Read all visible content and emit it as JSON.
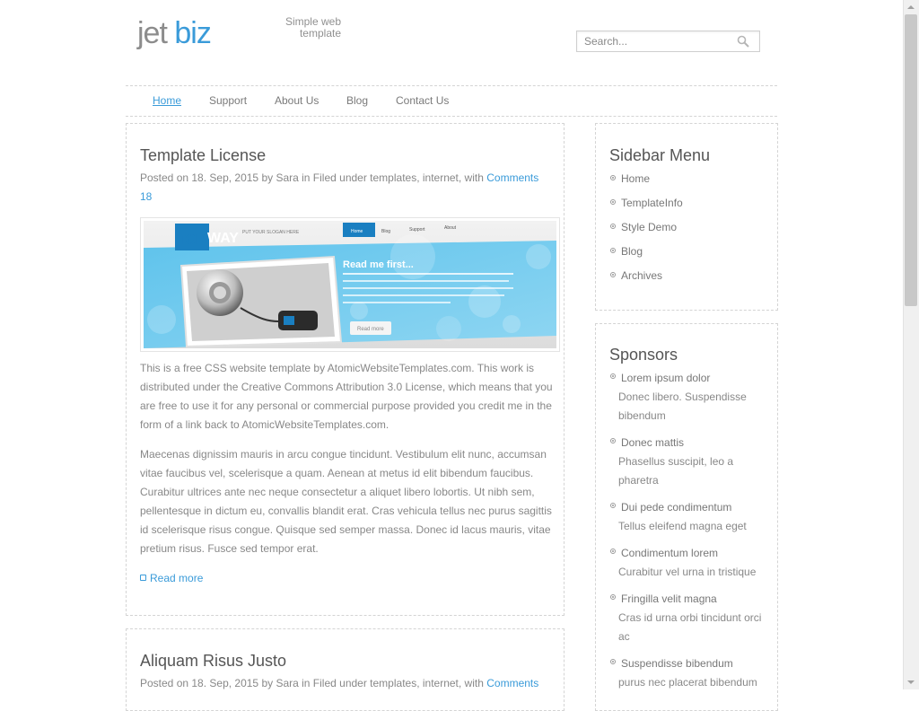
{
  "header": {
    "logo_part1": "jet",
    "logo_part2": "biz",
    "slogan_line1": "Simple web",
    "slogan_line2": "template",
    "search_placeholder": "Search..."
  },
  "nav": {
    "items": [
      {
        "label": "Home",
        "active": true
      },
      {
        "label": "Support"
      },
      {
        "label": "About Us"
      },
      {
        "label": "Blog"
      },
      {
        "label": "Contact Us"
      }
    ]
  },
  "posts": [
    {
      "title": "Template License",
      "meta_prefix": "Posted on 18. Sep, 2015 by Sara in Filed under templates, internet, with ",
      "meta_link": "Comments 18",
      "image": {
        "brand_top": "TOP",
        "brand_way": "WAY",
        "slogan": "PUT YOUR SLOGAN HERE",
        "tabs": [
          "Home",
          "Blog",
          "Support",
          "About"
        ],
        "heading": "Read me first...",
        "button": "Read more"
      },
      "para1": "This is a free CSS website template by AtomicWebsiteTemplates.com. This work is distributed under the Creative Commons Attribution 3.0 License, which means that you are free to use it for any personal or commercial purpose provided you credit me in the form of a link back to AtomicWebsiteTemplates.com.",
      "para2": "Maecenas dignissim mauris in arcu congue tincidunt. Vestibulum elit nunc, accumsan vitae faucibus vel, scelerisque a quam. Aenean at metus id elit bibendum faucibus. Curabitur ultrices ante nec neque consectetur a aliquet libero lobortis. Ut nibh sem, pellentesque in dictum eu, convallis blandit erat. Cras vehicula tellus nec purus sagittis id scelerisque risus congue. Quisque sed semper massa. Donec id lacus mauris, vitae pretium risus. Fusce sed tempor erat.",
      "read_more": "Read more"
    },
    {
      "title": "Aliquam Risus Justo",
      "meta_prefix": "Posted on 18. Sep, 2015 by Sara in Filed under templates, internet, with ",
      "meta_link": "Comments"
    }
  ],
  "sidebar": {
    "menu_title": "Sidebar Menu",
    "menu_items": [
      "Home",
      "TemplateInfo",
      "Style Demo",
      "Blog",
      "Archives"
    ],
    "sponsors_title": "Sponsors",
    "sponsors": [
      {
        "title": "Lorem ipsum dolor",
        "desc": "Donec libero. Suspendisse bibendum"
      },
      {
        "title": "Donec mattis",
        "desc": "Phasellus suscipit, leo a pharetra"
      },
      {
        "title": "Dui pede condimentum",
        "desc": "Tellus eleifend magna eget"
      },
      {
        "title": "Condimentum lorem",
        "desc": "Curabitur vel urna in tristique"
      },
      {
        "title": "Fringilla velit magna",
        "desc": "Cras id urna orbi tincidunt orci ac"
      },
      {
        "title": "Suspendisse bibendum",
        "desc": "purus nec placerat bibendum"
      }
    ]
  },
  "colors": {
    "accent": "#3a9bd9",
    "text": "#888888",
    "heading": "#555555",
    "border": "#d4d4d4"
  }
}
